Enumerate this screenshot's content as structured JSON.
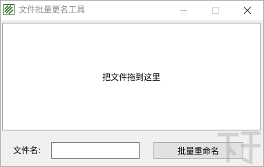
{
  "window": {
    "title": "文件批量更名工具"
  },
  "icons": {
    "app": "app-logo-icon",
    "minimize": "minimize-icon",
    "maximize": "maximize-icon",
    "close": "close-icon"
  },
  "drop_zone": {
    "text": "把文件拖到这里"
  },
  "form": {
    "filename_label": "文件名:",
    "filename_value": "",
    "rename_button": "批量重命名"
  },
  "colors": {
    "titlebar_bg": "#ffffff",
    "window_bg": "#f0f0f0",
    "button_bg": "#e1e1e1",
    "title_text": "#8a8a8a"
  }
}
